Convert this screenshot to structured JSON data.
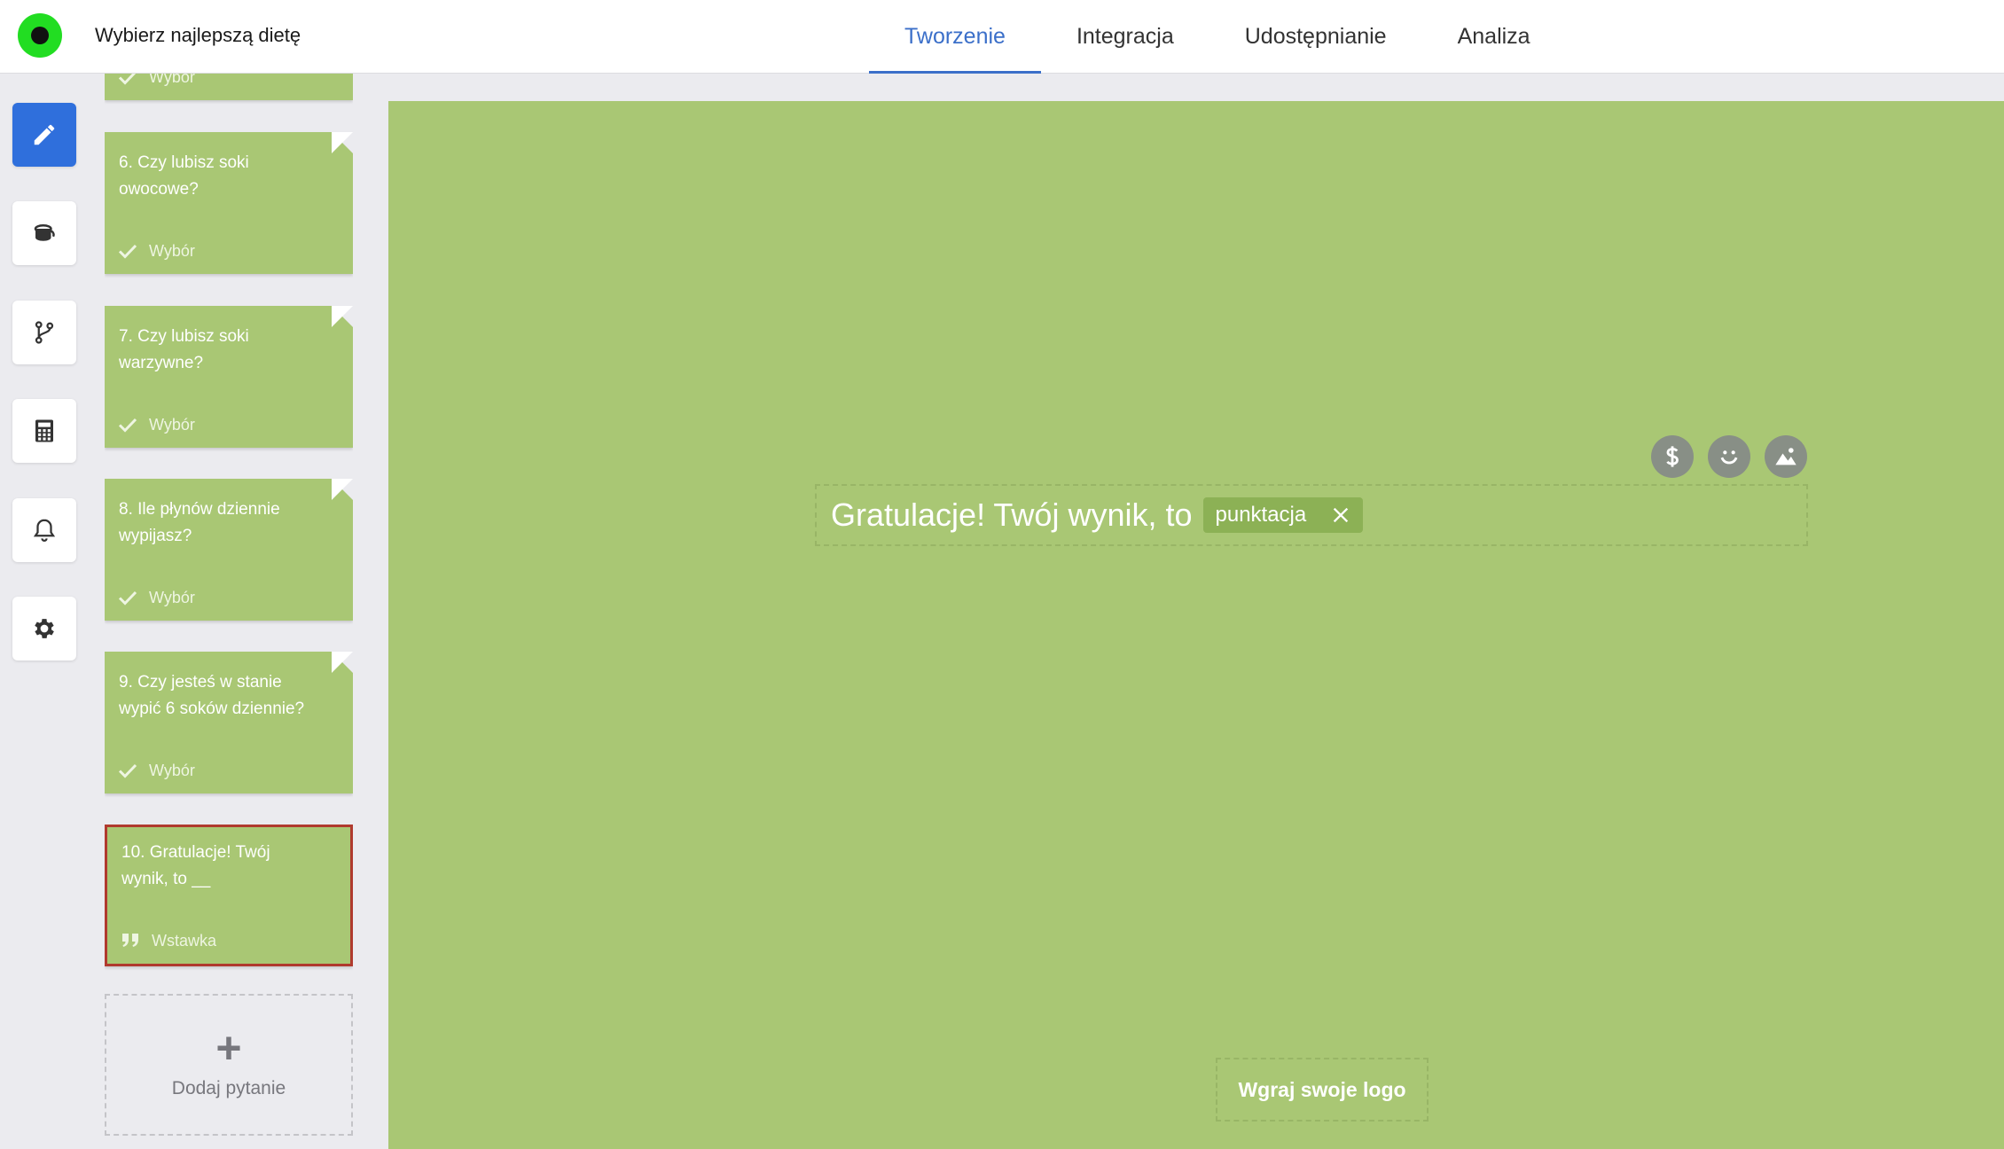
{
  "header": {
    "title": "Wybierz najlepszą dietę",
    "tabs": [
      {
        "label": "Tworzenie",
        "active": true
      },
      {
        "label": "Integracja",
        "active": false
      },
      {
        "label": "Udostępnianie",
        "active": false
      },
      {
        "label": "Analiza",
        "active": false
      }
    ]
  },
  "toolbar": {
    "items": [
      {
        "icon": "pencil-icon",
        "active": true
      },
      {
        "icon": "paint-bucket-icon",
        "active": false
      },
      {
        "icon": "branch-icon",
        "active": false
      },
      {
        "icon": "calculator-icon",
        "active": false
      },
      {
        "icon": "bell-icon",
        "active": false
      },
      {
        "icon": "gear-icon",
        "active": false
      }
    ]
  },
  "questions": {
    "partial_type": "Wybór",
    "items": [
      {
        "title": "6. Czy lubisz soki owocowe?",
        "type": "Wybór",
        "icon": "check-icon"
      },
      {
        "title": "7. Czy lubisz soki warzywne?",
        "type": "Wybór",
        "icon": "check-icon"
      },
      {
        "title": "8. Ile płynów dziennie wypijasz?",
        "type": "Wybór",
        "icon": "check-icon"
      },
      {
        "title": "9. Czy jesteś w stanie wypić 6 soków dziennie?",
        "type": "Wybór",
        "icon": "check-icon"
      },
      {
        "title": "10. Gratulacje! Twój wynik, to __",
        "type": "Wstawka",
        "icon": "quote-icon",
        "selected": true
      }
    ],
    "add_label": "Dodaj pytanie"
  },
  "canvas": {
    "result_text": "Gratulacje! Twój wynik, to",
    "chip_label": "punktacja",
    "upload_logo_label": "Wgraj swoje logo"
  },
  "colors": {
    "accent": "#3b6fc9",
    "card_green": "#a9c774",
    "selected_border": "#b03a2e"
  }
}
